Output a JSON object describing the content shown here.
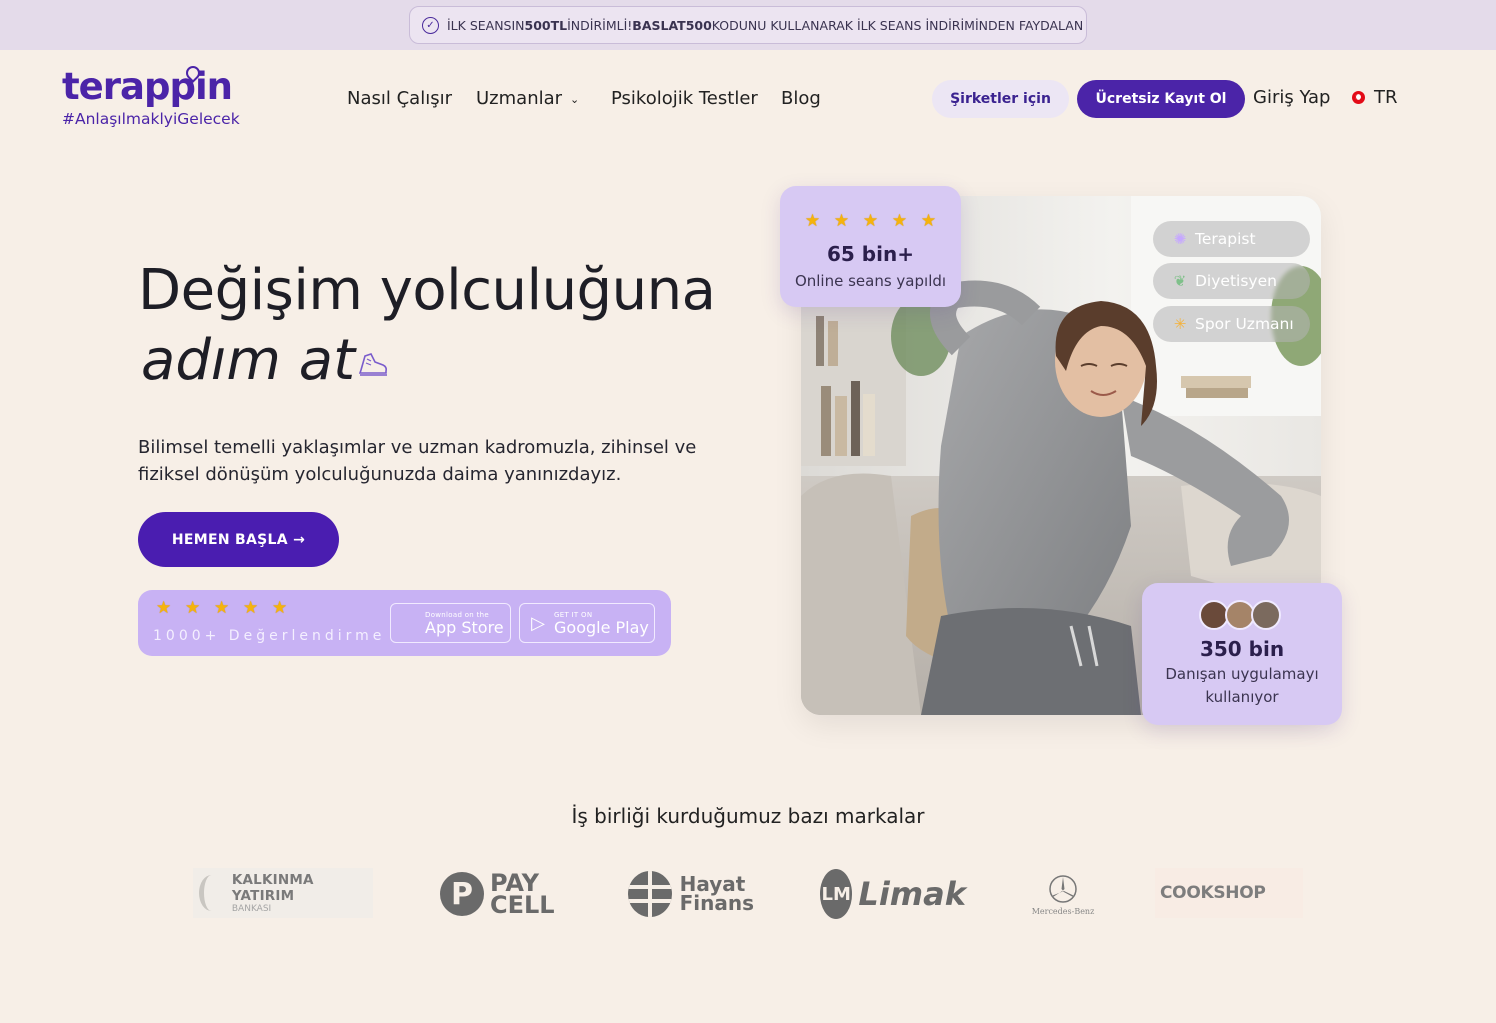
{
  "promo": {
    "prefix": "İLK SEANSIN ",
    "amount": "500TL",
    "middle": " İNDİRİMLİ! ",
    "code": "BASLAT500",
    "suffix": " KODUNU KULLANARAK İLK SEANS İNDİRİMİNDEN FAYDALAN"
  },
  "logo": {
    "name": "terappin",
    "tagline": "#AnlaşılmaklyiGelecek"
  },
  "nav": {
    "items": [
      "Nasıl Çalışır",
      "Uzmanlar",
      "Psikolojik Testler",
      "Blog"
    ],
    "corporate_label": "Şirketler için",
    "signup_label": "Ücretsiz Kayıt Ol",
    "login_label": "Giriş Yap",
    "language": "TR"
  },
  "hero": {
    "title": "Değişim yolculuğuna",
    "subtitle": "adım at",
    "description": "Bilimsel temelli yaklaşımlar ve uzman kadromuzla, zihinsel ve fiziksel dönüşüm yolculuğunuzda daima yanınızdayız.",
    "cta_label": "HEMEN BAŞLA →"
  },
  "rating": {
    "stars": 5,
    "label": "1000+ Değerlendirme"
  },
  "stores": {
    "apple_small": "Download on the",
    "apple_large": "App Store",
    "google_small": "GET IT ON",
    "google_large": "Google Play"
  },
  "chips": [
    "Terapist",
    "Diyetisyen",
    "Spor Uzmanı"
  ],
  "stat_sessions": {
    "stars": 5,
    "value": "65 bin+",
    "label": "Online seans yapıldı"
  },
  "stat_clients": {
    "value": "350 bin",
    "label": "Danışan uygulamayı kullanıyor"
  },
  "partners": {
    "title": "İş birliği kurduğumuz bazı markalar",
    "logos": [
      "KALKINMA YATIRIM",
      "BANKASI",
      "PAY",
      "CELL",
      "Hayat",
      "Finans",
      "Limak",
      "Mercedes-Benz",
      "COOKSHOP"
    ]
  },
  "colors": {
    "primary": "#4b24a8",
    "background": "#f7efe7",
    "card": "#d7c9f3",
    "star": "#f5b30d"
  }
}
